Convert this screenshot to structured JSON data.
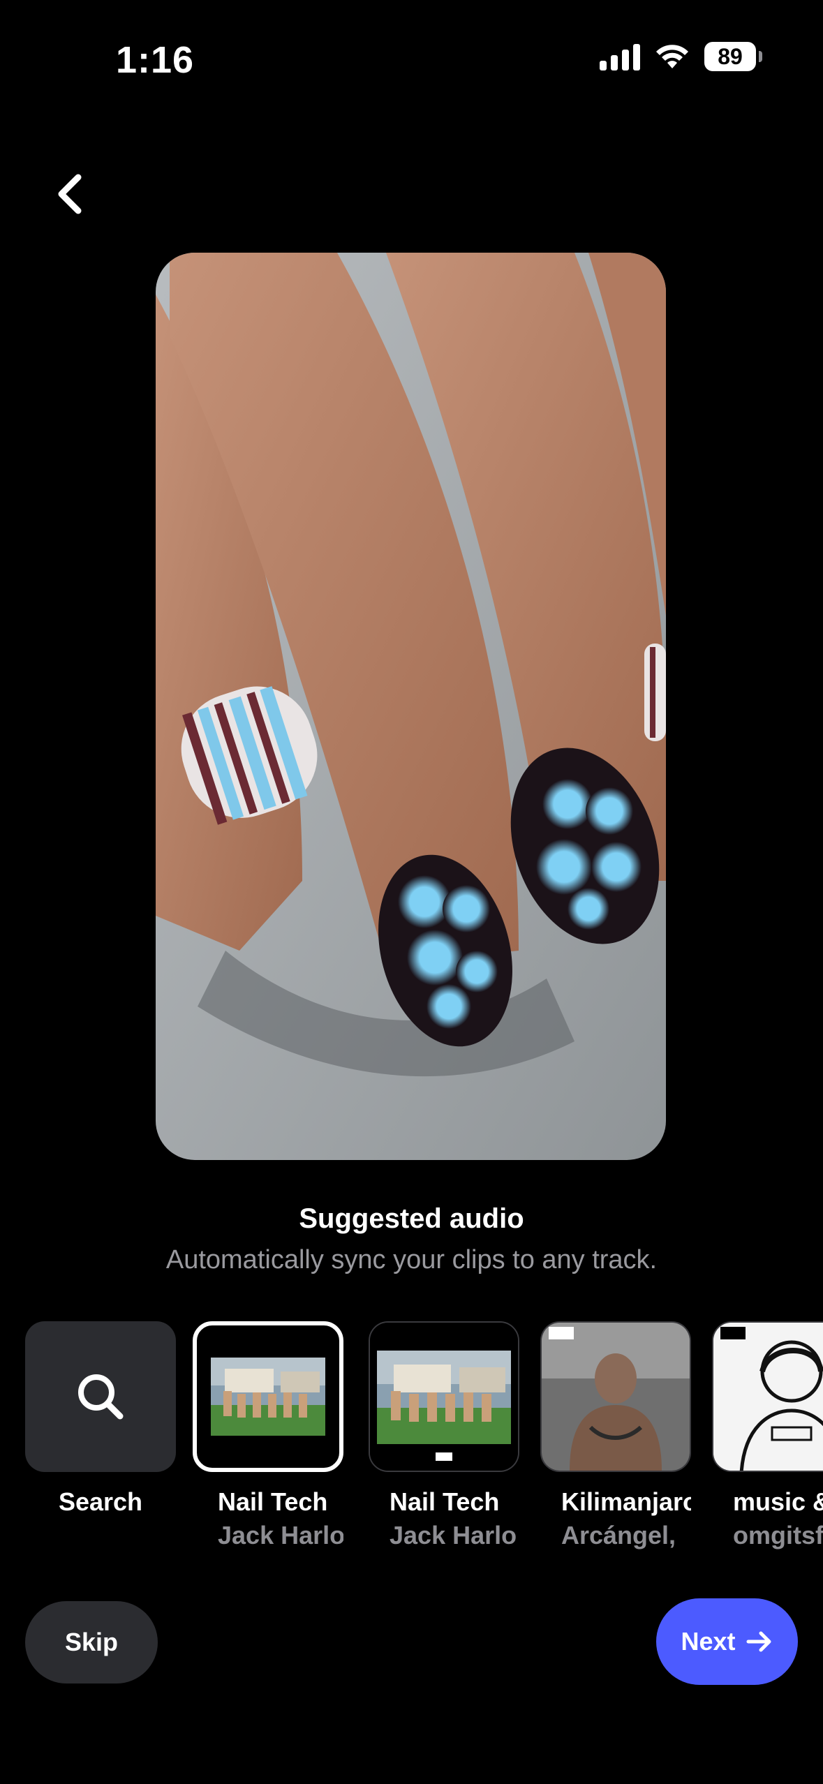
{
  "status": {
    "time": "1:16",
    "battery": "89"
  },
  "heading": "Suggested audio",
  "subheading": "Automatically sync your clips to any track.",
  "tracks": [
    {
      "title": "Search",
      "artist": ""
    },
    {
      "title": "Nail Tech",
      "artist": "Jack Harlo"
    },
    {
      "title": "Nail Tech",
      "artist": "Jack Harlo"
    },
    {
      "title": "Kilimanjaro",
      "artist": "Arcángel, "
    },
    {
      "title": "music &",
      "artist": "omgitsf"
    }
  ],
  "buttons": {
    "skip": "Skip",
    "next": "Next"
  },
  "colors": {
    "accent": "#4c5bff",
    "background": "#000000",
    "tile": "#2b2c30"
  }
}
